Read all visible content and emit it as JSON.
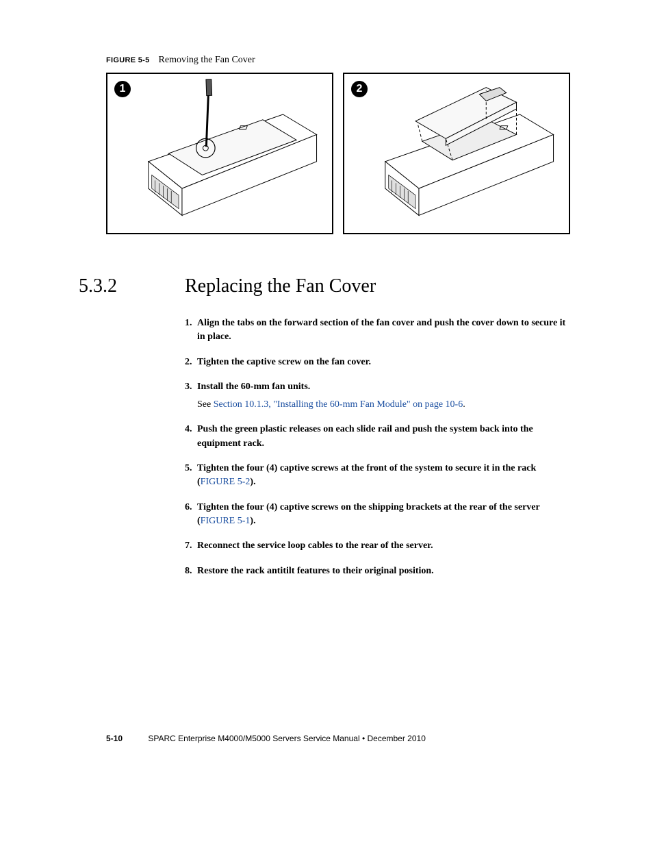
{
  "figure": {
    "label": "FIGURE 5-5",
    "title": "Removing the Fan Cover",
    "panel1": "1",
    "panel2": "2"
  },
  "section": {
    "number": "5.3.2",
    "title": "Replacing the Fan Cover"
  },
  "steps": {
    "n1": "1.",
    "t1": "Align the tabs on the forward section of the fan cover and push the cover down to secure it in place.",
    "n2": "2.",
    "t2": "Tighten the captive screw on the fan cover.",
    "n3": "3.",
    "t3": "Install the 60-mm fan units.",
    "t3see": "See ",
    "t3link": "Section 10.1.3, \"Installing the 60-mm Fan Module\" on page 10-6",
    "t3dot": ".",
    "n4": "4.",
    "t4": "Push the green plastic releases on each slide rail and push the system back into the equipment rack.",
    "n5": "5.",
    "t5a": "Tighten the four (4) captive screws at the front of the system to secure it in the rack (",
    "t5link": "FIGURE 5-2",
    "t5b": ").",
    "n6": "6.",
    "t6a": "Tighten the four (4) captive screws on the shipping brackets at the rear of the server (",
    "t6link": "FIGURE 5-1",
    "t6b": ").",
    "n7": "7.",
    "t7": "Reconnect the service loop cables to the rear of the server.",
    "n8": "8.",
    "t8": "Restore the rack antitilt features to their original position."
  },
  "footer": {
    "pageno": "5-10",
    "text": "SPARC Enterprise M4000/M5000 Servers Service Manual  •  December 2010"
  }
}
